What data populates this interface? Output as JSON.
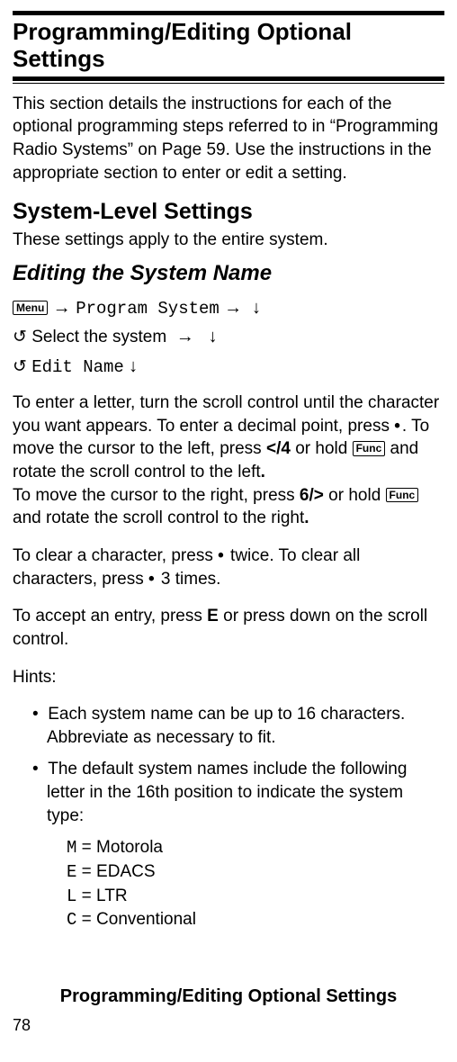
{
  "title": "Programming/Editing Optional Settings",
  "intro": "This section details the instructions for each of the optional programming steps referred to in “Program­ming Radio Systems” on Page 59. Use the instructions in the appropriate section to enter or edit a setting.",
  "h2": "System-Level Settings",
  "h2_sub": "These settings apply to the entire system.",
  "h3": "Editing the System Name",
  "nav": {
    "menu_key": "Menu",
    "l1a": "Program System",
    "l2a": "Select the system",
    "l3a": "Edit Name"
  },
  "para1a": "To enter a letter, turn the scroll control until the character you want appears. To enter a decimal point, press ",
  "para1b": ". To move the cursor to the left, press ",
  "para1c": "/4",
  "para1d": " or hold ",
  "para1e": " and rotate the scroll control to the left",
  "para2a": "To move the cursor to the right, press ",
  "para2b": "6/",
  "para2c": " or hold ",
  "para2d": " and rotate the scroll control to the right",
  "para3a": "To clear a character, press ",
  "para3b": " twice. To clear all characters, press ",
  "para3c": " 3 times.",
  "para4a": "To accept an entry, press ",
  "para4b": "E",
  "para4c": " or press down on the scroll control.",
  "func_key": "Func",
  "hints_label": "Hints:",
  "hint1": "Each system name can be up to 16 characters. Abbreviate as necessary to fit.",
  "hint2": "The default system names include the following letter in the 16th position to indicate the system type:",
  "types": {
    "m_code": "M",
    "m_label": " = Motorola",
    "e_code": "E",
    "e_label": " = EDACS",
    "l_code": "L",
    "l_label": " = LTR",
    "c_code": "C",
    "c_label": " = Conventional"
  },
  "footer": "Programming/Editing Optional Settings",
  "page_number": "78"
}
